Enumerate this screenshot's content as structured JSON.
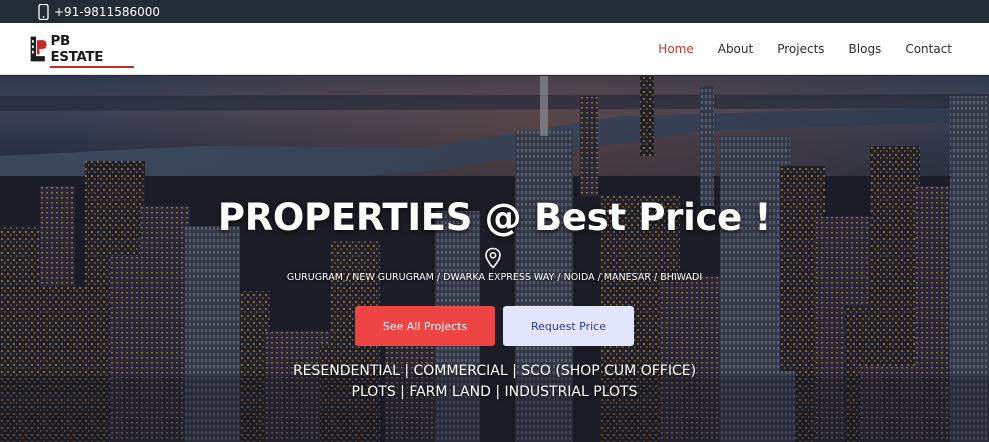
{
  "topbar": {
    "phone_icon": "mobile-phone-icon",
    "phone": "+91-9811586000"
  },
  "navbar": {
    "logo_text": "PB ESTATE",
    "items": [
      {
        "label": "Home",
        "active": true
      },
      {
        "label": "About",
        "active": false
      },
      {
        "label": "Projects",
        "active": false
      },
      {
        "label": "Blogs",
        "active": false
      },
      {
        "label": "Contact",
        "active": false
      }
    ]
  },
  "hero": {
    "title": "PROPERTIES @ Best Price !",
    "location_icon": "map-pin-icon",
    "locations": "GURUGRAM / NEW GURUGRAM / DWARKA EXPRESS WAY / NOIDA / MANESAR / BHIWADI",
    "primary_button": "See All Projects",
    "secondary_button": "Request Price",
    "types_line1": "RESENDENTIAL | COMMERCIAL | SCO (SHOP CUM OFFICE)",
    "types_line2": "PLOTS | FARM LAND | INDUSTRIAL PLOTS"
  },
  "colors": {
    "topbar_bg": "#232b37",
    "active_nav": "#c0392b",
    "primary_button": "#ef4444",
    "secondary_button": "#e2e5fb"
  }
}
